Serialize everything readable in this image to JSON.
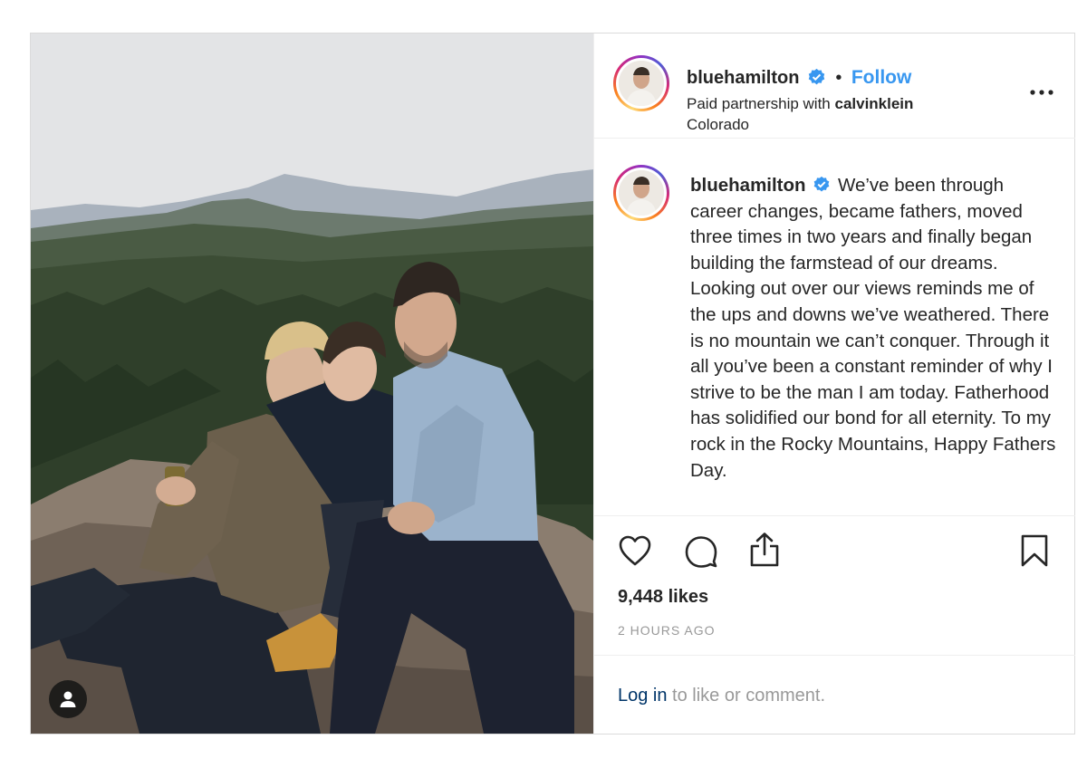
{
  "post": {
    "username": "bluehamilton",
    "follow_label": "Follow",
    "separator": "•",
    "partnership_prefix": "Paid partnership with ",
    "partner": "calvinklein",
    "location": "Colorado",
    "more_icon": "more-horizontal-icon",
    "caption": "We’ve been through career changes, became fathers, moved three times in two years and finally began building the farmstead of our dreams. Looking out over our views reminds me of the ups and downs we’ve weathered. There is no mountain we can’t conquer. Through it all you’ve been a constant reminder of why I strive to be the man I am today. Fatherhood has solidified our bond for all eternity. To my rock in the Rocky Mountains, Happy Fathers Day.",
    "likes": "9,448 likes",
    "timestamp": "2 HOURS AGO",
    "login_link": "Log in",
    "login_suffix": " to like or comment."
  },
  "icons": {
    "like": "heart-icon",
    "comment": "comment-icon",
    "share": "share-icon",
    "save": "bookmark-icon",
    "tag": "user-tag-icon",
    "verified": "verified-badge-icon"
  },
  "colors": {
    "accent": "#3897f0",
    "text": "#262626",
    "muted": "#999999",
    "link": "#003569",
    "border": "#dbdbdb"
  }
}
